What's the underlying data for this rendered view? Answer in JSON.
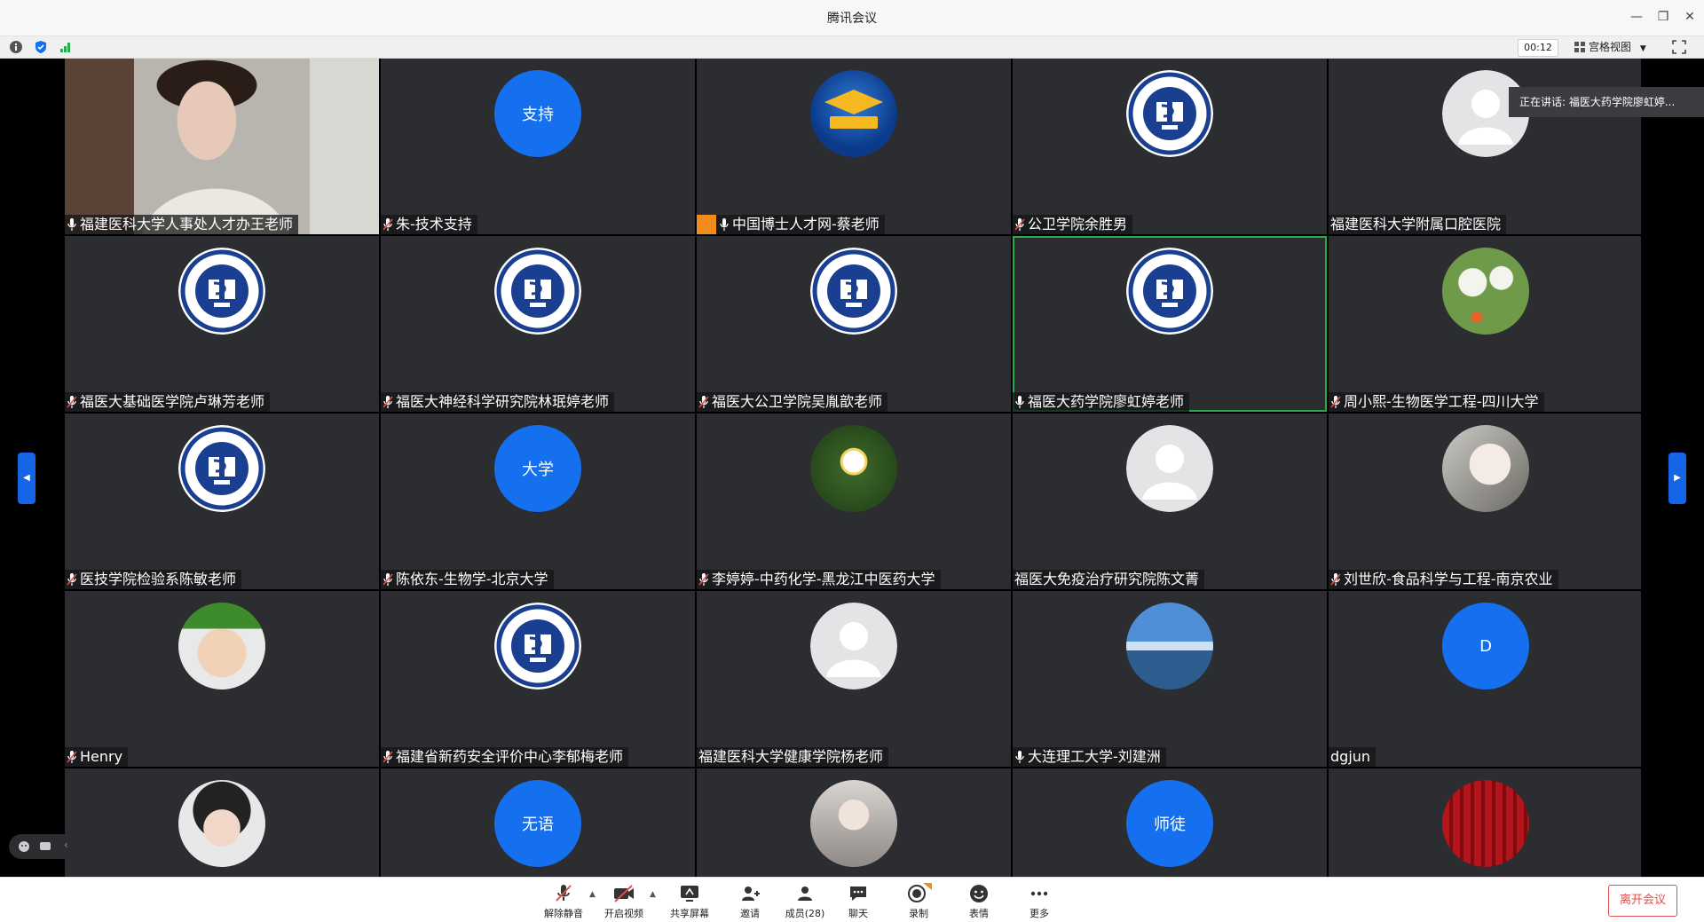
{
  "window": {
    "title": "腾讯会议"
  },
  "statusbar": {
    "timer": "00:12",
    "view_label": "宫格视图"
  },
  "speaking_banner": "正在讲话: 福医大药学院廖虹婷...",
  "participants": [
    {
      "name": "福建医科大学人事处人才办王老师",
      "avatar": "video",
      "mic": "on"
    },
    {
      "name": "朱-技术支持",
      "avatar": "text",
      "avatar_text": "支持",
      "mic": "muted"
    },
    {
      "name": "中国博士人才网-蔡老师",
      "avatar": "phd-logo",
      "mic": "on",
      "badge": true
    },
    {
      "name": "公卫学院余胜男",
      "avatar": "fjmu-logo",
      "mic": "muted"
    },
    {
      "name": "福建医科大学附属口腔医院",
      "avatar": "default",
      "mic": "none"
    },
    {
      "name": "福医大基础医学院卢琳芳老师",
      "avatar": "fjmu-logo",
      "mic": "muted"
    },
    {
      "name": "福医大神经科学研究院林珉婷老师",
      "avatar": "fjmu-logo",
      "mic": "muted"
    },
    {
      "name": "福医大公卫学院吴胤歆老师",
      "avatar": "fjmu-logo",
      "mic": "muted"
    },
    {
      "name": "福医大药学院廖虹婷老师",
      "avatar": "fjmu-logo",
      "mic": "on",
      "active": true
    },
    {
      "name": "周小熙-生物医学工程-四川大学",
      "avatar": "photo-green",
      "mic": "muted"
    },
    {
      "name": "医技学院检验系陈敏老师",
      "avatar": "fjmu-logo",
      "mic": "muted"
    },
    {
      "name": "陈依东-生物学-北京大学",
      "avatar": "text",
      "avatar_text": "大学",
      "mic": "muted"
    },
    {
      "name": "李婷婷-中药化学-黑龙江中医药大学",
      "avatar": "photo-lotus",
      "mic": "muted"
    },
    {
      "name": "福医大免疫治疗研究院陈文菁",
      "avatar": "default",
      "mic": "none"
    },
    {
      "name": "刘世欣-食品科学与工程-南京农业",
      "avatar": "photo-anime",
      "mic": "muted"
    },
    {
      "name": "Henry",
      "avatar": "photo-baby",
      "mic": "muted"
    },
    {
      "name": "福建省新药安全评价中心李郁梅老师",
      "avatar": "fjmu-logo",
      "mic": "muted"
    },
    {
      "name": "福建医科大学健康学院杨老师",
      "avatar": "default",
      "mic": "none"
    },
    {
      "name": "大连理工大学-刘建洲",
      "avatar": "photo-lake",
      "mic": "on"
    },
    {
      "name": "dgjun",
      "avatar": "text",
      "avatar_text": "D",
      "mic": "none"
    },
    {
      "name": "",
      "avatar": "photo-cartoon",
      "mic": "none"
    },
    {
      "name": "",
      "avatar": "text",
      "avatar_text": "无语",
      "mic": "none"
    },
    {
      "name": "",
      "avatar": "photo-woman",
      "mic": "none"
    },
    {
      "name": "",
      "avatar": "text",
      "avatar_text": "师徒",
      "mic": "none"
    },
    {
      "name": "",
      "avatar": "photo-red",
      "mic": "none"
    }
  ],
  "toolbar": {
    "unmute": "解除静音",
    "start_video": "开启视频",
    "share_screen": "共享屏幕",
    "invite": "邀请",
    "members": "成员(28)",
    "chat": "聊天",
    "record": "录制",
    "reactions": "表情",
    "more": "更多",
    "leave": "离开会议"
  },
  "colors": {
    "accent_blue": "#1570ef",
    "leave_red": "#e34d4d",
    "tile_bg": "#2b2d30",
    "active_border": "#2ea84d"
  }
}
